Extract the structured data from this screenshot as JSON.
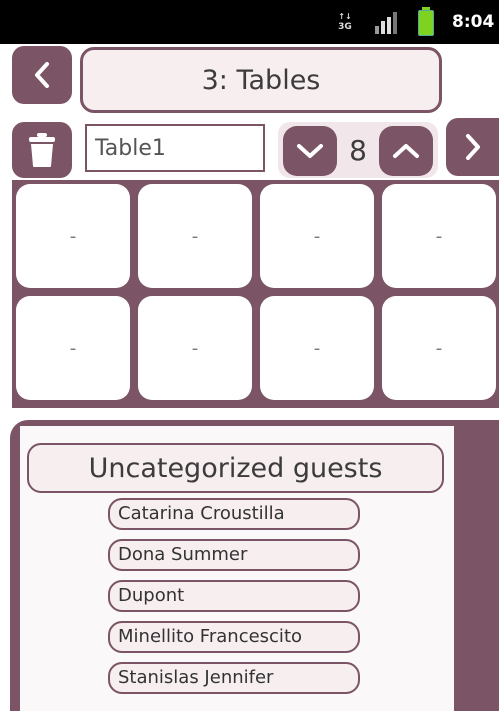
{
  "status_bar": {
    "network_label": "3G",
    "time": "8:04"
  },
  "header": {
    "title": "3: Tables"
  },
  "table_editor": {
    "name_value": "Table1",
    "seat_count": "8"
  },
  "seats": [
    "-",
    "-",
    "-",
    "-",
    "-",
    "-",
    "-",
    "-"
  ],
  "guests": {
    "category_title": "Uncategorized guests",
    "items": [
      "Catarina Croustilla",
      "Dona Summer",
      "Dupont",
      "Minellito Francescito",
      "Stanislas Jennifer"
    ]
  },
  "colors": {
    "accent": "#7b5466",
    "light_fill": "#f7eef0"
  }
}
